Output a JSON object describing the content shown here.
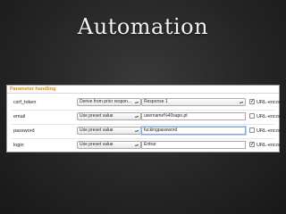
{
  "slide": {
    "title": "Automation"
  },
  "panel": {
    "title": "Parameter handling",
    "encode_label": "URL-encode",
    "rows": [
      {
        "name": "csrf_token",
        "source": "Derive from prior respon...",
        "value": "Response 1",
        "value_is_select": true,
        "encode": true
      },
      {
        "name": "email",
        "source": "Use preset value",
        "value": "username%40sapo.pt",
        "value_is_select": false,
        "encode": false
      },
      {
        "name": "password",
        "source": "Use preset value",
        "value": "fuckingpassword",
        "value_is_select": false,
        "encode": false
      },
      {
        "name": "login",
        "source": "Use preset value",
        "value": "Entrar",
        "value_is_select": false,
        "encode": true
      }
    ]
  },
  "icons": {
    "dropdown": "up-down-arrows-icon",
    "check": "checkmark-icon"
  }
}
